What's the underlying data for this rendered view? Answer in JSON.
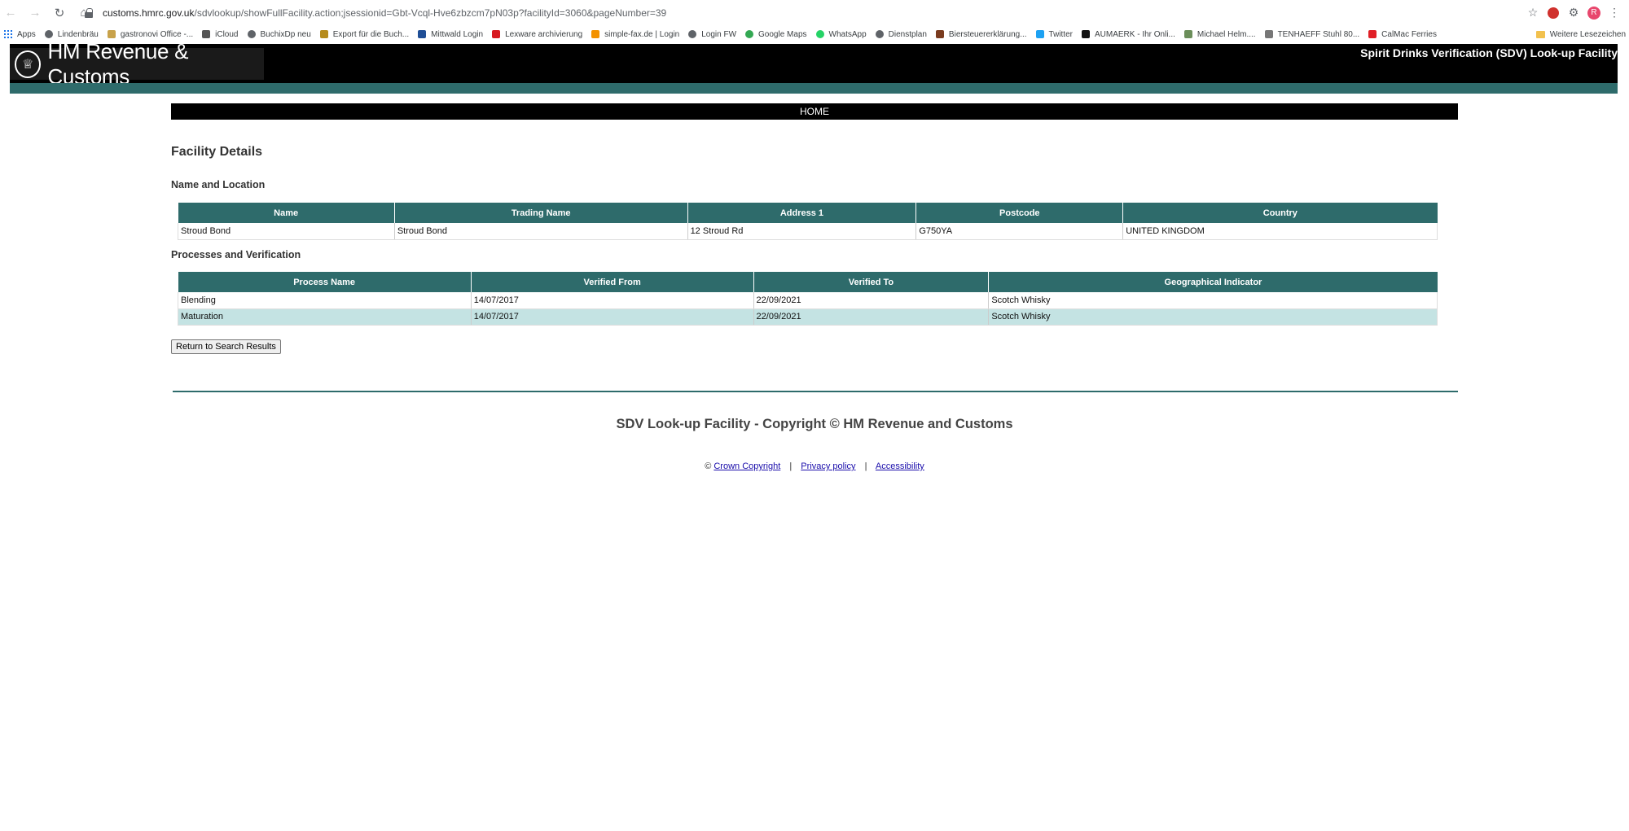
{
  "browser": {
    "url_host": "customs.hmrc.gov.uk",
    "url_path": "/sdvlookup/showFullFacility.action;jsessionid=Gbt-Vcql-Hve6zbzcm7pN03p?facilityId=3060&pageNumber=39",
    "avatar_letter": "R",
    "bookmarks": [
      {
        "label": "Apps",
        "icon": "apps-grid-icon",
        "color": "#1a73e8"
      },
      {
        "label": "Lindenbräu",
        "icon": "globe-icon",
        "color": "#5f6368"
      },
      {
        "label": "gastronovi Office -...",
        "icon": "gastronovi-icon",
        "color": "#c8a24a"
      },
      {
        "label": "iCloud",
        "icon": "apple-icon",
        "color": "#555555"
      },
      {
        "label": "BuchixDp neu",
        "icon": "globe-icon",
        "color": "#5f6368"
      },
      {
        "label": "Export für die Buch...",
        "icon": "export-icon",
        "color": "#b58b1c"
      },
      {
        "label": "Mittwald Login",
        "icon": "mittwald-icon",
        "color": "#1f4e96"
      },
      {
        "label": "Lexware archivierung",
        "icon": "lexware-icon",
        "color": "#d71920"
      },
      {
        "label": "simple-fax.de | Login",
        "icon": "fax-icon",
        "color": "#f39200"
      },
      {
        "label": "Login FW",
        "icon": "globe-icon",
        "color": "#5f6368"
      },
      {
        "label": "Google Maps",
        "icon": "map-pin-icon",
        "color": "#34a853"
      },
      {
        "label": "WhatsApp",
        "icon": "whatsapp-icon",
        "color": "#25d366"
      },
      {
        "label": "Dienstplan",
        "icon": "globe-icon",
        "color": "#5f6368"
      },
      {
        "label": "Biersteuererklärung...",
        "icon": "beer-icon",
        "color": "#7a3b1e"
      },
      {
        "label": "Twitter",
        "icon": "twitter-icon",
        "color": "#1da1f2"
      },
      {
        "label": "AUMAERK - Ihr Onli...",
        "icon": "aumaerk-icon",
        "color": "#111111"
      },
      {
        "label": "Michael Helm....",
        "icon": "photo-icon",
        "color": "#6b8e5a"
      },
      {
        "label": "TENHAEFF Stuhl 80...",
        "icon": "chair-icon",
        "color": "#777777"
      },
      {
        "label": "CalMac Ferries",
        "icon": "calmac-icon",
        "color": "#e01f26"
      }
    ],
    "more_bookmarks": "»",
    "other_bookmarks": "Weitere Lesezeichen"
  },
  "header": {
    "department": "HM Revenue & Customs",
    "service": "Spirit Drinks Verification (SDV) Look-up Facility"
  },
  "menu": {
    "home": "HOME"
  },
  "page": {
    "title": "Facility Details",
    "section_name_location": "Name and Location",
    "section_processes": "Processes and Verification",
    "return_button": "Return to Search Results"
  },
  "name_location_table": {
    "headers": [
      "Name",
      "Trading Name",
      "Address 1",
      "Postcode",
      "Country"
    ],
    "rows": [
      [
        "Stroud Bond",
        "Stroud Bond",
        "12 Stroud Rd",
        "G750YA",
        "UNITED KINGDOM"
      ]
    ]
  },
  "processes_table": {
    "headers": [
      "Process Name",
      "Verified From",
      "Verified To",
      "Geographical Indicator"
    ],
    "rows": [
      [
        "Blending",
        "14/07/2017",
        "22/09/2021",
        "Scotch Whisky"
      ],
      [
        "Maturation",
        "14/07/2017",
        "22/09/2021",
        "Scotch Whisky"
      ]
    ]
  },
  "footer": {
    "title": "SDV Look-up Facility - Copyright © HM Revenue and Customs",
    "copyright_symbol": "©",
    "crown_copyright": "Crown Copyright",
    "separator": "|",
    "privacy_policy": "Privacy policy",
    "accessibility": "Accessibility"
  },
  "colors": {
    "hmrc_teal": "#2e6b6b",
    "alt_row": "#c4e3e3",
    "header_black": "#000000"
  }
}
